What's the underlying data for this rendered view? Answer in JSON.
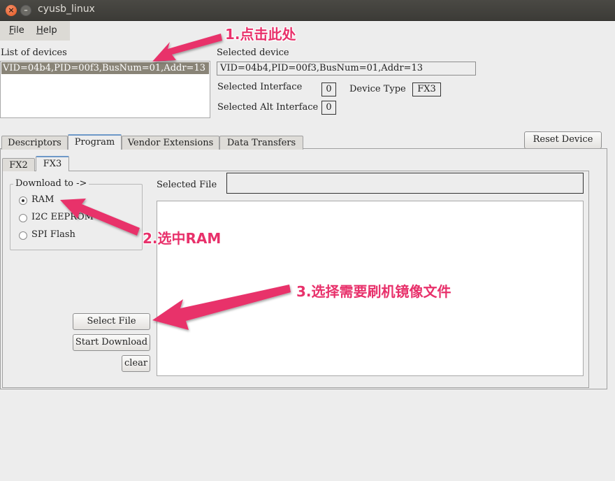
{
  "window": {
    "title": "cyusb_linux"
  },
  "menu": {
    "file_rest": "ile",
    "file_key": "F",
    "help_rest": "elp",
    "help_key": "H"
  },
  "devices": {
    "list_label": "List of devices",
    "items": [
      "VID=04b4,PID=00f3,BusNum=01,Addr=13"
    ],
    "selected_label": "Selected device",
    "selected_value": "VID=04b4,PID=00f3,BusNum=01,Addr=13",
    "interface_label": "Selected Interface",
    "interface_value": "0",
    "alt_interface_label": "Selected Alt Interface",
    "alt_interface_value": "0",
    "device_type_label": "Device Type",
    "device_type_value": "FX3"
  },
  "tabs": [
    "Descriptors",
    "Program",
    "Vendor Extensions",
    "Data Transfers"
  ],
  "active_tab": "Program",
  "reset_button": "Reset Device",
  "subtabs": [
    "FX2",
    "FX3"
  ],
  "active_subtab": "FX3",
  "program": {
    "download_to_label": "Download to ->",
    "options": [
      "RAM",
      "I2C EEPROM",
      "SPI Flash"
    ],
    "selected_option": "RAM",
    "selected_file_label": "Selected File",
    "selected_file_value": "",
    "select_file_button": "Select File",
    "start_download_button": "Start Download",
    "clear_button": "clear"
  },
  "annotations": {
    "step1": "1.点击此处",
    "step2": "2.选中RAM",
    "step3": "3.选择需要刷机镜像文件",
    "color": "#e8316b"
  }
}
